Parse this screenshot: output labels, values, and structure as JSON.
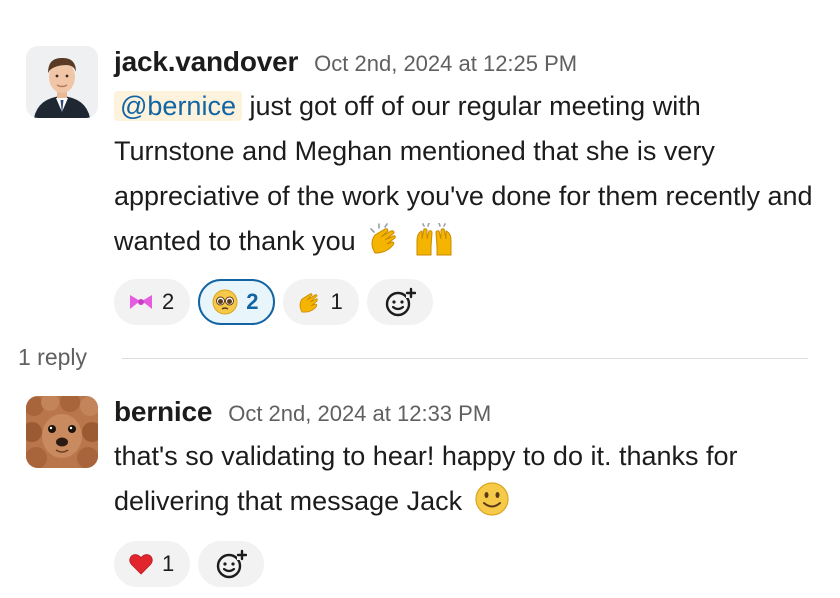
{
  "thread": {
    "reply_count": "1 reply"
  },
  "messages": [
    {
      "author": "jack.vandover",
      "timestamp": "Oct 2nd, 2024 at 12:25 PM",
      "avatar_icon": "man-in-suit-photo",
      "mention": "@bernice",
      "text_after_mention": " just got off of our regular meeting with Turnstone and Meghan mentioned that she is very appreciative of the work you've done for them recently and wanted to thank you",
      "trailing_emoji": [
        "clapping-hands-emoji",
        "raising-hands-emoji"
      ],
      "reactions": [
        {
          "icon": "pink-bow-emoji",
          "count": "2",
          "active": false
        },
        {
          "icon": "pleading-face-emoji",
          "count": "2",
          "active": true
        },
        {
          "icon": "clapping-hands-emoji",
          "count": "1",
          "active": false
        }
      ]
    },
    {
      "author": "bernice",
      "timestamp": "Oct 2nd, 2024 at 12:33 PM",
      "avatar_icon": "dog-photo",
      "text": "that's so validating to hear! happy to do it. thanks for delivering that message Jack",
      "trailing_emoji": [
        "smiling-face-emoji"
      ],
      "reactions": [
        {
          "icon": "red-heart-emoji",
          "count": "1",
          "active": false
        }
      ]
    }
  ],
  "colors": {
    "mention_bg": "#fdf2dc",
    "mention_text": "#1264a3",
    "active_reaction_border": "#1264a3",
    "timestamp": "#616061"
  }
}
